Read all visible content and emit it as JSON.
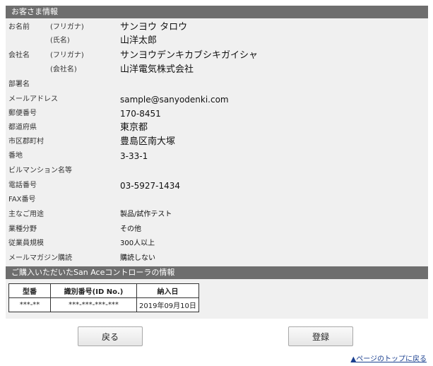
{
  "customer": {
    "header": "お客さま情報",
    "name_label": "お名前",
    "furigana_label": "(フリガナ)",
    "name_sub_label": "(氏名)",
    "name_furigana": "サンヨウ タロウ",
    "name": "山洋太郎",
    "company_label": "会社名",
    "company_furigana_label": "(フリガナ)",
    "company_sub_label": "(会社名)",
    "company_furigana": "サンヨウデンキカブシキガイシャ",
    "company": "山洋電気株式会社",
    "department_label": "部署名",
    "department": "",
    "email_label": "メールアドレス",
    "email": "sample@sanyodenki.com",
    "postal_label": "郵便番号",
    "postal": "170-8451",
    "prefecture_label": "都道府県",
    "prefecture": "東京都",
    "city_label": "市区郡町村",
    "city": "豊島区南大塚",
    "address_label": "番地",
    "address": "3-33-1",
    "building_label": "ビルマンション名等",
    "building": "",
    "phone_label": "電話番号",
    "phone": "03-5927-1434",
    "fax_label": "FAX番号",
    "fax": "",
    "usage_label": "主なご用途",
    "usage": "製品/試作テスト",
    "industry_label": "業種分野",
    "industry": "その他",
    "employees_label": "従業員規模",
    "employees": "300人以上",
    "newsletter_label": "メールマガジン購読",
    "newsletter": "購読しない"
  },
  "product": {
    "header": "ご購入いただいたSan Aceコントローラの情報",
    "columns": [
      "型番",
      "識別番号(ID No.)",
      "納入日"
    ],
    "rows": [
      [
        "***-**",
        "***-***-***-***",
        "2019年09月10日"
      ]
    ]
  },
  "buttons": {
    "back": "戻る",
    "register": "登録"
  },
  "top_link": "▲ページのトップに戻る"
}
